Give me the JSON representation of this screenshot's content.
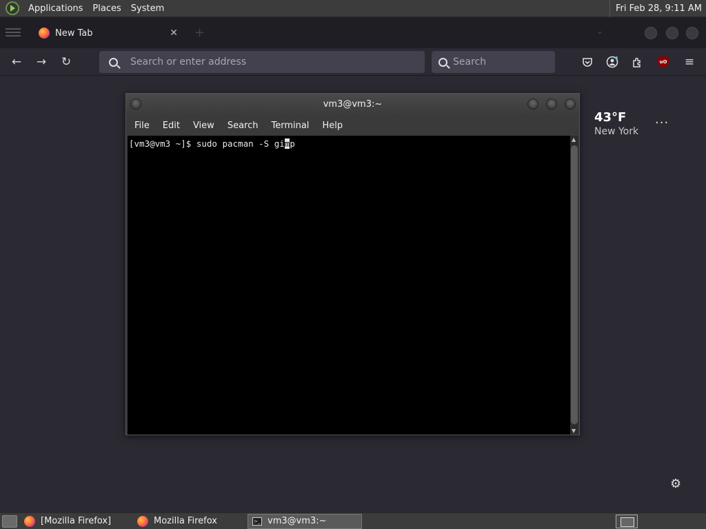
{
  "top_panel": {
    "menus": [
      "Applications",
      "Places",
      "System"
    ],
    "clock": "Fri Feb 28,  9:11 AM"
  },
  "browser": {
    "tab": {
      "title": "New Tab",
      "close": "✕"
    },
    "new_tab_symbol": "+",
    "address_placeholder": "Search or enter address",
    "search_placeholder": "Search",
    "ublock_label": "uO",
    "weather": {
      "temp": "43°F",
      "city": "New York"
    },
    "more_symbol": "···",
    "settings_symbol": "⚙"
  },
  "terminal": {
    "title": "vm3@vm3:~",
    "menu": [
      "File",
      "Edit",
      "View",
      "Search",
      "Terminal",
      "Help"
    ],
    "prompt": "[vm3@vm3 ~]$ ",
    "command_before_cursor": "sudo pacman -S gi",
    "cursor_char": "m",
    "command_after_cursor": "p"
  },
  "taskbar": {
    "tasks": [
      "[Mozilla Firefox]",
      "Mozilla Firefox",
      "vm3@vm3:~"
    ]
  },
  "colors": {
    "desktop_bg": "#2b2a33",
    "panel_bg": "#3c3c3c",
    "terminal_bg": "#000000",
    "input_bg": "#42414d"
  }
}
